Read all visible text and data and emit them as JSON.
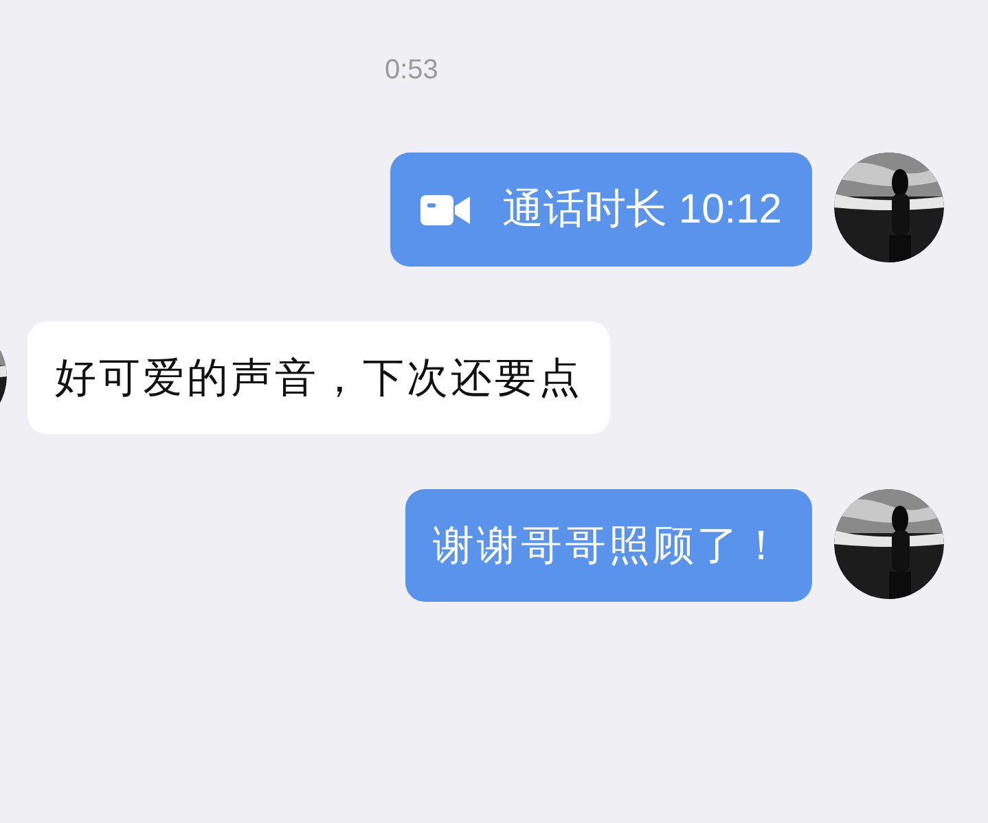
{
  "timestamp": "0:53",
  "messages": [
    {
      "outgoing": true,
      "kind": "call",
      "text": "通话时长 10:12"
    },
    {
      "outgoing": false,
      "kind": "text",
      "text": "好可爱的声音，下次还要点"
    },
    {
      "outgoing": true,
      "kind": "text",
      "text": "谢谢哥哥照顾了！"
    }
  ]
}
